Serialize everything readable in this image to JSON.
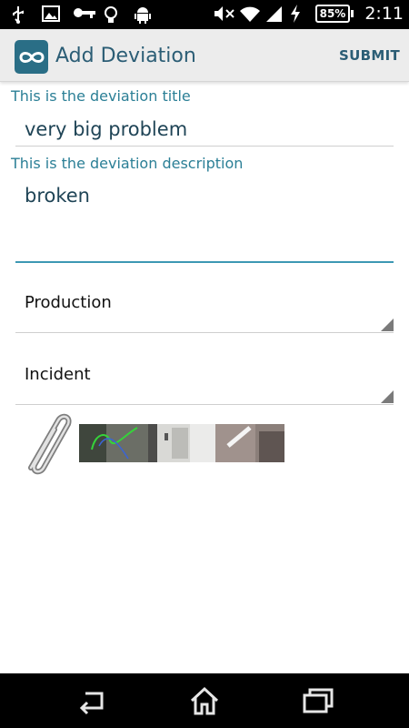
{
  "status_bar": {
    "icons": [
      "usb-icon",
      "image-icon",
      "key-icon",
      "bulb-icon",
      "android-icon",
      "mute-icon",
      "wifi-icon",
      "signal-icon",
      "charging-icon"
    ],
    "battery": "85%",
    "time": "2:11"
  },
  "action_bar": {
    "title": "Add Deviation",
    "submit_label": "SUBMIT",
    "brand_color": "#2a6e86"
  },
  "form": {
    "title_label": "This is the deviation title",
    "title_value": "very big problem",
    "description_label": "This is the deviation description",
    "description_value": "broken",
    "category": "Production",
    "type": "Incident"
  },
  "attachments": {
    "icon": "paperclip-icon",
    "count": 3
  },
  "nav_bar": {
    "icons": [
      "back-icon",
      "home-icon",
      "recents-icon"
    ]
  }
}
